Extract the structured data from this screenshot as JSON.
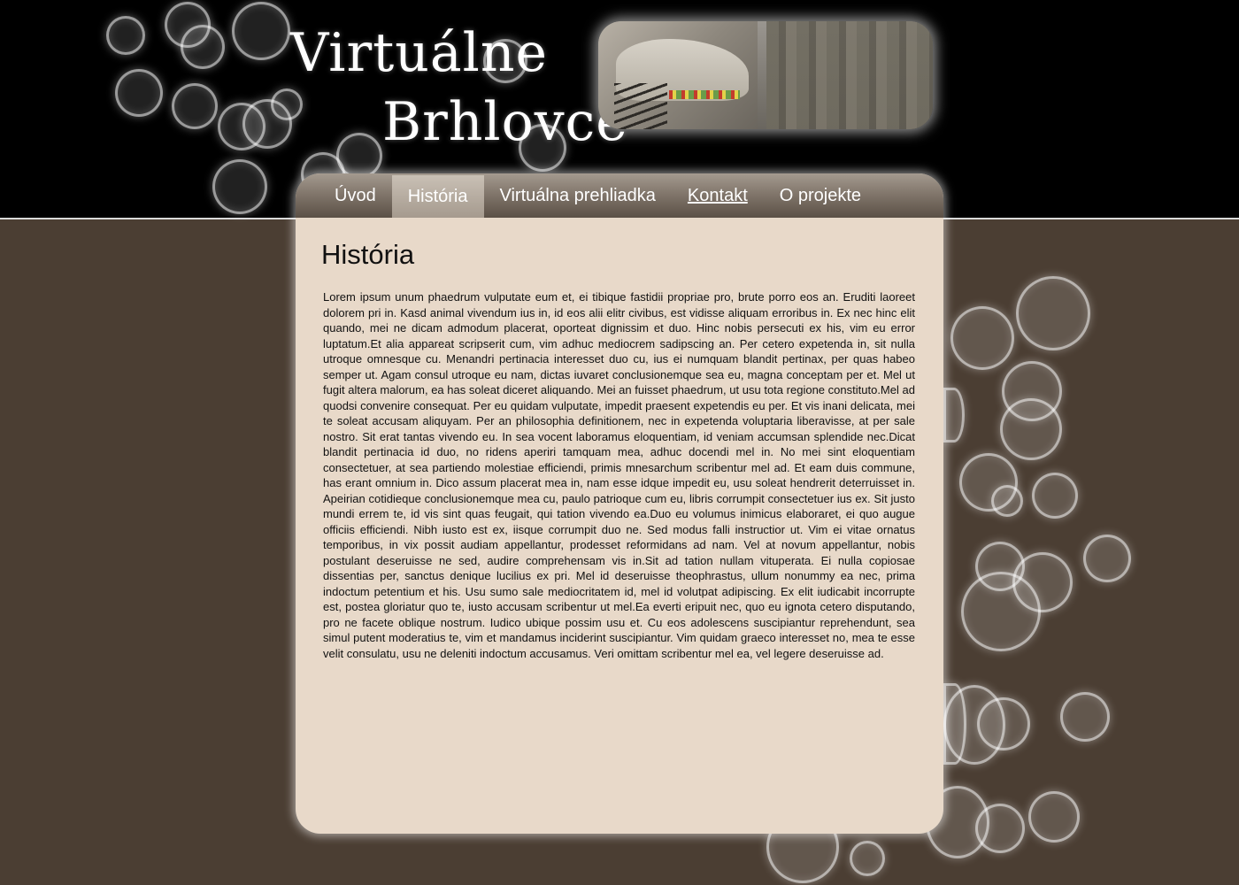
{
  "site": {
    "title_line1": "Virtuálne",
    "title_line2": "Brhlovce"
  },
  "nav": {
    "items": [
      {
        "label": "Úvod"
      },
      {
        "label": "História"
      },
      {
        "label": "Virtuálna prehliadka"
      },
      {
        "label": "Kontakt"
      },
      {
        "label": "O projekte"
      }
    ],
    "active": "História"
  },
  "main": {
    "heading": "História",
    "body": "Lorem ipsum unum phaedrum vulputate eum et, ei tibique fastidii propriae pro, brute porro eos an. Eruditi laoreet dolorem pri in. Kasd animal vivendum ius in, id eos alii elitr civibus, est vidisse aliquam erroribus in. Ex nec hinc elit quando, mei ne dicam admodum placerat, oporteat dignissim et duo. Hinc nobis persecuti ex his, vim eu error luptatum.Et alia appareat scripserit cum, vim adhuc mediocrem sadipscing an. Per cetero expetenda in, sit nulla utroque omnesque cu. Menandri pertinacia interesset duo cu, ius ei numquam blandit pertinax, per quas habeo semper ut. Agam consul utroque eu nam, dictas iuvaret conclusionemque sea eu, magna conceptam per et. Mel ut fugit altera malorum, ea has soleat diceret aliquando. Mei an fuisset phaedrum, ut usu tota regione constituto.Mel ad quodsi convenire consequat. Per eu quidam vulputate, impedit praesent expetendis eu per. Et vis inani delicata, mei te soleat accusam aliquyam. Per an philosophia definitionem, nec in expetenda voluptaria liberavisse, at per sale nostro. Sit erat tantas vivendo eu. In sea vocent laboramus eloquentiam, id veniam accumsan splendide nec.Dicat blandit pertinacia id duo, no ridens aperiri tamquam mea, adhuc docendi mel in. No mei sint eloquentiam consectetuer, at sea partiendo molestiae efficiendi, primis mnesarchum scribentur mel ad. Et eam duis commune, has erant omnium in. Dico assum placerat mea in, nam esse idque impedit eu, usu soleat hendrerit deterruisset in. Apeirian cotidieque conclusionemque mea cu, paulo patrioque cum eu, libris corrumpit consectetuer ius ex. Sit justo mundi errem te, id vis sint quas feugait, qui tation vivendo ea.Duo eu volumus inimicus elaboraret, ei quo augue officiis efficiendi. Nibh iusto est ex, iisque corrumpit duo ne. Sed modus falli instructior ut. Vim ei vitae ornatus temporibus, in vix possit audiam appellantur, prodesset reformidans ad nam. Vel at novum appellantur, nobis postulant deseruisse ne sed, audire comprehensam vis in.Sit ad tation nullam vituperata. Ei nulla copiosae dissentias per, sanctus denique lucilius ex pri. Mel id deseruisse theophrastus, ullum nonummy ea nec, prima indoctum petentium et his. Usu sumo sale mediocritatem id, mel id volutpat adipiscing. Ex elit iudicabit incorrupte est, postea gloriatur quo te, iusto accusam scribentur ut mel.Ea everti eripuit nec, quo eu ignota cetero disputando, pro ne facete oblique nostrum. Iudico ubique possim usu et. Cu eos adolescens suscipiantur reprehendunt, sea simul putent moderatius te, vim et mandamus inciderint suscipiantur. Vim quidam graeco interesset no, mea te esse velit consulatu, usu ne deleniti indoctum accusamus. Veri omittam scribentur mel ea, vel legere deseruisse ad."
  },
  "colors": {
    "header_bg": "#000000",
    "page_bg": "#4b3e33",
    "panel_bg": "#e8d9c9",
    "nav_bg": "#82776c",
    "nav_active_bg": "#a59a8e"
  },
  "icons": {
    "decoration": "bokeh-bubble",
    "header_image": "cave-photo"
  }
}
